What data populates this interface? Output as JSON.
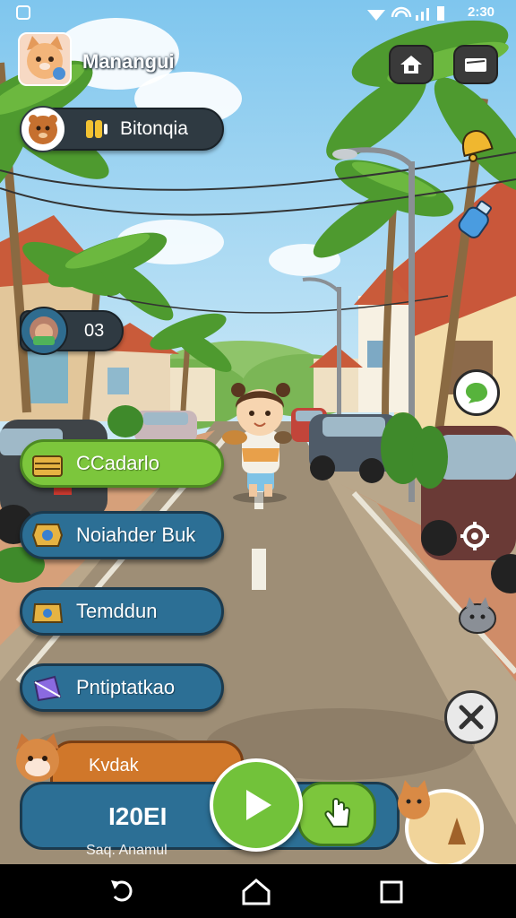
{
  "status_bar": {
    "time": "2:30"
  },
  "player": {
    "name": "Manangui"
  },
  "currency": {
    "label": "Bitonqia"
  },
  "level": {
    "value": "03"
  },
  "menu": [
    {
      "label": "CCadarlo",
      "icon": "crate-icon",
      "color": "#7cc63c"
    },
    {
      "label": "Noiahder Buk",
      "icon": "badge-icon",
      "color": "#2c6f95"
    },
    {
      "label": "Temddun",
      "icon": "chest-icon",
      "color": "#2c6f95"
    },
    {
      "label": "Pntiptatkao",
      "icon": "box-icon",
      "color": "#2c6f95"
    }
  ],
  "bottom_panel": {
    "tab_label": "Kvdak",
    "score": "I20EI",
    "footer_text": "Saq. Anamul"
  },
  "colors": {
    "green": "#7cc63c",
    "blue": "#2c6f95",
    "orange": "#d0772a",
    "dark_pill": "#2f3a42"
  }
}
